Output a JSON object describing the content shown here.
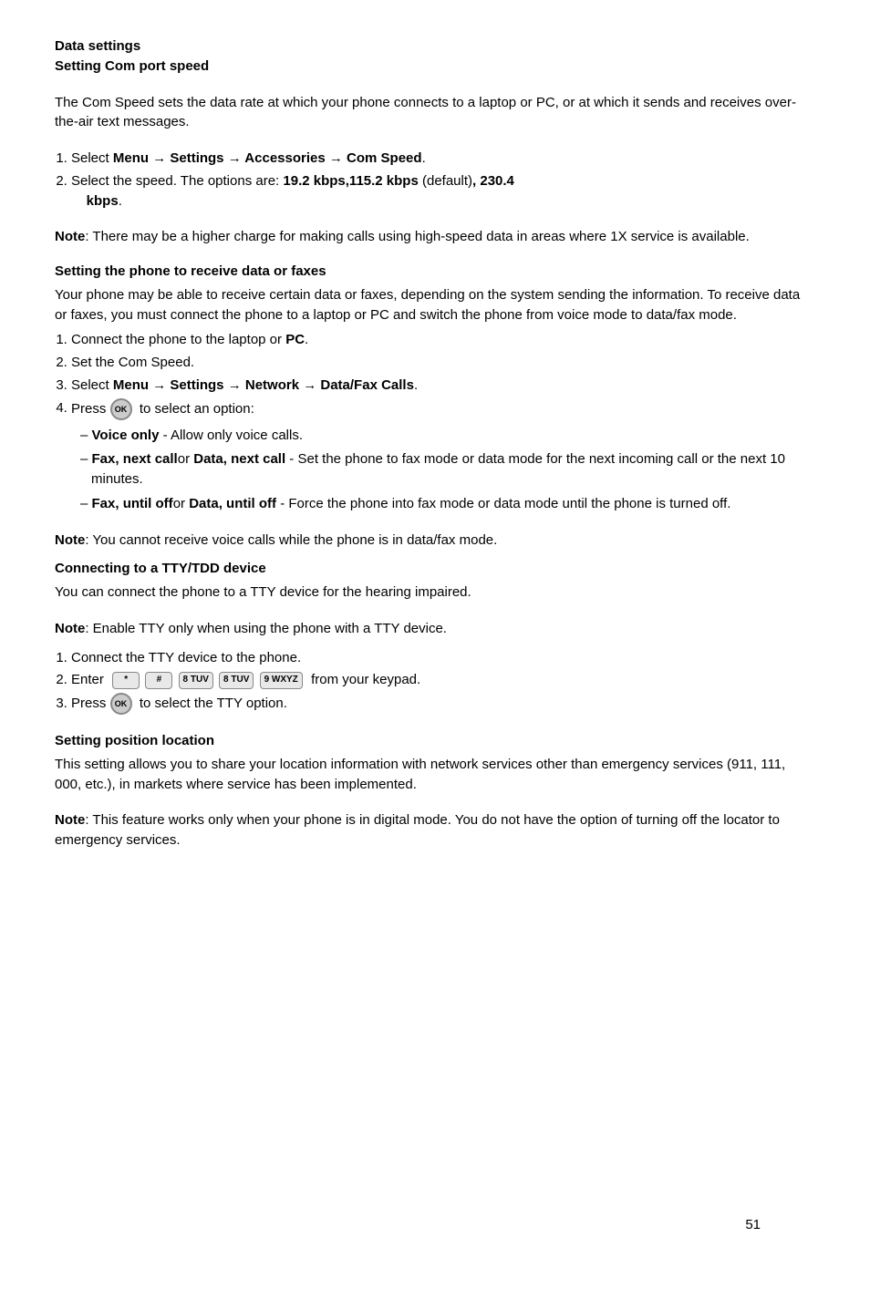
{
  "page": {
    "number": "51",
    "sections": [
      {
        "id": "data-settings-header",
        "heading1": "Data settings",
        "heading2": "Setting Com port speed"
      },
      {
        "id": "com-port-intro",
        "text": "The Com Speed sets the data rate at which your phone connects to a laptop or PC, or at which it sends and receives over-the-air text messages."
      },
      {
        "id": "com-port-steps",
        "steps": [
          {
            "text_pre": "Select ",
            "bold": "Menu → Settings → Accessories → Com Speed",
            "text_post": "."
          },
          {
            "text_pre": "Select the speed. The options are: ",
            "bold": "19.2 kbps,115.2 kbps",
            "text_mid": " (default)",
            "bold2": ", 230.4 kbps",
            "text_post": "."
          }
        ]
      },
      {
        "id": "note-high-charge",
        "note_label": "Note",
        "text": ": There may be a higher charge for making calls using high-speed data in areas where 1X service is available."
      },
      {
        "id": "receive-data-faxes",
        "heading": "Setting the phone to receive data or faxes",
        "intro": "Your phone may be able to receive certain data or faxes, depending on the system sending the information. To receive data or faxes, you must connect the phone to a laptop or PC and switch the phone from voice mode to data/fax mode.",
        "steps": [
          "Connect the phone to the laptop or <b>PC</b>.",
          "Set the Com Speed.",
          "Select <b>Menu → Settings → Network → Data/Fax Calls</b>.",
          "Press <ok-icon> to select an option:"
        ],
        "options": [
          "<b>Voice only</b> - Allow only voice calls.",
          "<b>Fax, next call</b>or <b>Data, next call</b> - Set the phone to fax mode or data mode for the next incoming call or the next 10 minutes.",
          "<b>Fax, until off</b>or <b>Data, until off</b> - Force the phone into fax mode or data mode until the phone is turned off."
        ]
      },
      {
        "id": "note-voice-calls",
        "note_label": "Note",
        "text": ": You cannot receive voice calls while the phone is in data/fax mode."
      },
      {
        "id": "tty-tdd",
        "heading": "Connecting to a TTY/TDD device",
        "intro": "You can connect the phone to a TTY device for the hearing impaired."
      },
      {
        "id": "note-tty-enable",
        "note_label": "Note",
        "text": ": Enable TTY only when using the phone with a TTY device."
      },
      {
        "id": "tty-steps",
        "steps": [
          "Connect the TTY device to the phone.",
          "Enter <keypad-icons> from your keypad.",
          "Press <ok-icon> to select the TTY option."
        ]
      },
      {
        "id": "position-location",
        "heading": "Setting position location",
        "intro": "This setting allows you to share your location information with network services other than emergency services (911, 111, 000, etc.), in markets where service has been implemented."
      },
      {
        "id": "note-digital-mode",
        "note_label": "Note",
        "text": ": This feature works only when your phone is in digital mode. You do not have the option of turning off the locator to emergency services."
      }
    ],
    "keypad_icons": [
      {
        "label": "*"
      },
      {
        "label": "#"
      },
      {
        "label": "8 TUV"
      },
      {
        "label": "8 TUV"
      },
      {
        "label": "9 WXYZ"
      }
    ]
  }
}
